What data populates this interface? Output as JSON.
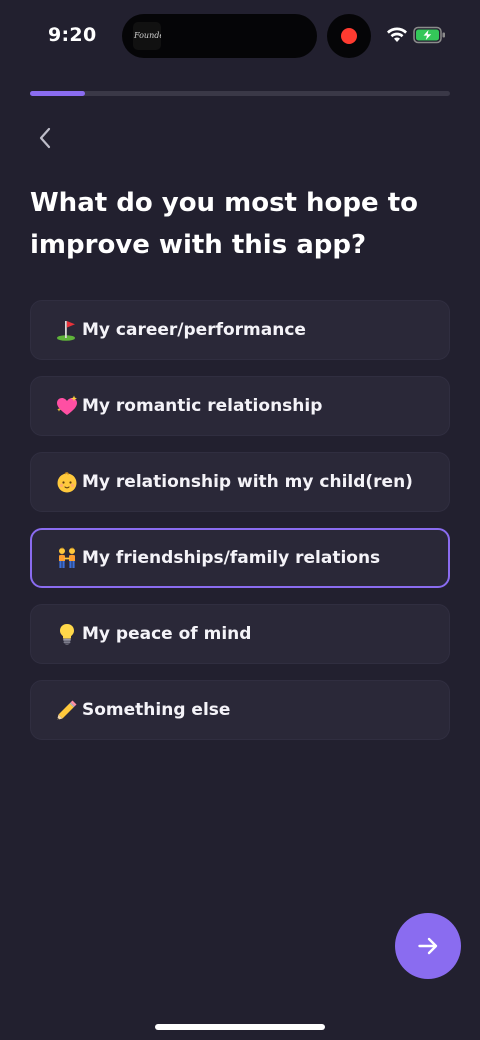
{
  "status_bar": {
    "time": "9:20",
    "island_thumbnail_text": "Founders",
    "icons": [
      "wifi-icon",
      "battery-charging-icon",
      "screen-recording-icon"
    ]
  },
  "progress": {
    "fraction": 0.13,
    "color": "#8a6cf0"
  },
  "nav": {
    "back_icon": "chevron-left-icon"
  },
  "question": "What do you most hope to improve with this app?",
  "options": [
    {
      "emoji": "⛳",
      "icon": "golf-flag-icon",
      "label": "My career/performance",
      "selected": false
    },
    {
      "emoji": "💖",
      "icon": "sparkling-heart-icon",
      "label": "My romantic relationship",
      "selected": false
    },
    {
      "emoji": "👶",
      "icon": "baby-icon",
      "label": "My relationship with my child(ren)",
      "selected": false
    },
    {
      "emoji": "🧑‍🤝‍🧑",
      "icon": "people-holding-hands-icon",
      "label": "My friendships/family relations",
      "selected": true
    },
    {
      "emoji": "💡",
      "icon": "light-bulb-icon",
      "label": "My peace of mind",
      "selected": false
    },
    {
      "emoji": "✏️",
      "icon": "pencil-icon",
      "label": "Something else",
      "selected": false
    }
  ],
  "next_button": {
    "icon": "arrow-right-icon"
  },
  "colors": {
    "background": "#22202f",
    "accent": "#8a6cf0",
    "option_bg": "#2a2838"
  }
}
